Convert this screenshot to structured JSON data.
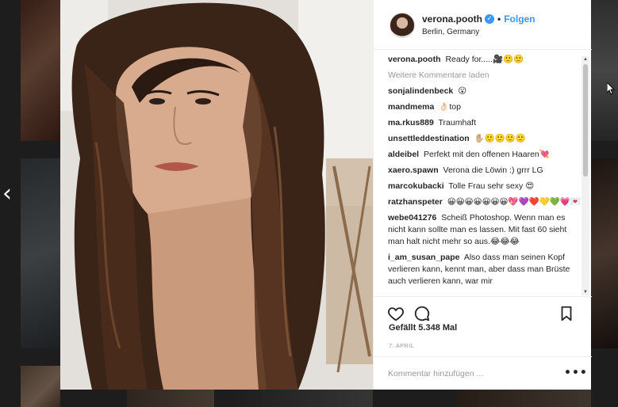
{
  "post": {
    "username": "verona.pooth",
    "verified_glyph": "✓",
    "separator": "•",
    "follow_label": "Folgen",
    "location": "Berlin, Germany",
    "image_alt": "Selfie of a woman with long dark wavy hair"
  },
  "comments": {
    "load_more_label": "Weitere Kommentare laden",
    "items": [
      {
        "user": "verona.pooth",
        "text": "Ready for.....🎥🙂🙂",
        "is_caption": true
      },
      {
        "user": "sonjalindenbeck",
        "text": "😮"
      },
      {
        "user": "mandmema",
        "text": "👌🏻top"
      },
      {
        "user": "ma.rkus889",
        "text": "Traumhaft"
      },
      {
        "user": "unsettleddestination",
        "text": "✋🏼🙂🙂🙂🙂"
      },
      {
        "user": "aldeibel",
        "text": "Perfekt mit den offenen Haaren💘"
      },
      {
        "user": "xaero.spawn",
        "text": "Verona die Löwin :) grrr LG"
      },
      {
        "user": "marcokubacki",
        "text": "Tolle Frau sehr sexy 😍"
      },
      {
        "user": "ratzhanspeter",
        "text": "😀😀😀😀😀😀😀💖💜❤️💛💚💗💌"
      },
      {
        "user": "webe041276",
        "text": "Scheiß Photoshop. Wenn man es nicht kann sollte man es lassen. Mit fast 60 sieht man halt nicht mehr so aus.😂😂😂"
      },
      {
        "user": "i_am_susan_pape",
        "text": "Also dass man seinen Kopf verlieren kann, kennt man, aber dass man Brüste auch verlieren kann, war mir"
      }
    ]
  },
  "actions": {
    "like_icon": "heart-outline-icon",
    "comment_icon": "speech-bubble-icon",
    "save_icon": "bookmark-icon"
  },
  "likes_text": "Gefällt 5.348 Mal",
  "date_text": "7. APRIL",
  "add_comment": {
    "placeholder": "Kommentar hinzufügen ...",
    "more_label": "•••"
  },
  "navigation": {
    "prev_glyph": "‹"
  },
  "colors": {
    "accent": "#3897f0",
    "text": "#262626",
    "muted": "#999999",
    "border": "#efefef"
  }
}
